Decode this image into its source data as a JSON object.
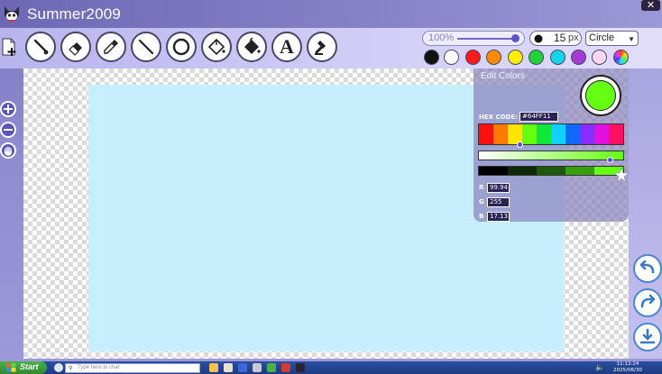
{
  "window": {
    "title": "Summer2009",
    "close_glyph": "✕"
  },
  "toolbar": {
    "tools": [
      {
        "name": "brush",
        "icon": "brush-icon"
      },
      {
        "name": "eraser",
        "icon": "eraser-icon"
      },
      {
        "name": "eyedropper",
        "icon": "eyedropper-icon"
      },
      {
        "name": "line",
        "icon": "line-icon"
      },
      {
        "name": "circle",
        "icon": "circle-icon"
      },
      {
        "name": "fill",
        "icon": "paint-bucket-icon"
      },
      {
        "name": "fill-dark",
        "icon": "paint-bucket-filled-icon"
      },
      {
        "name": "text",
        "icon": "text-icon",
        "glyph": "A"
      },
      {
        "name": "stamp",
        "icon": "stamp-icon"
      }
    ],
    "zoom": {
      "label": "100%",
      "level": 1.0
    },
    "brush_size": {
      "value": "15",
      "unit": "px"
    },
    "shape": {
      "selected": "Circle"
    },
    "palette": [
      "#111111",
      "#ffffff",
      "#ff1a1a",
      "#ff8c00",
      "#ffee00",
      "#1fd43a",
      "#12d6ea",
      "#a63ad6",
      "#ffd6ee"
    ]
  },
  "color_editor": {
    "title": "Edit Colors",
    "hex_label": "HEX CODE:",
    "hex_value": "#64FF11",
    "preview_color": "#64ff11",
    "hue_stops": [
      "#ff1010",
      "#ff7a00",
      "#ffe600",
      "#64ff11",
      "#10e63a",
      "#10d0ff",
      "#1068ff",
      "#8a2cff",
      "#e010e0",
      "#ff1060"
    ],
    "value_stops": [
      "#000000",
      "#0e2a04",
      "#1f5a0a",
      "#36a00e",
      "#64ff11"
    ],
    "r_label": "R",
    "r_value": "99.94",
    "g_label": "G",
    "g_value": "255",
    "b_label": "B",
    "b_value": "17.13"
  },
  "taskbar": {
    "start_label": "Start",
    "search_placeholder": "Type here to chat",
    "clock_time": "11:12:24",
    "clock_date": "2025/06/30"
  }
}
